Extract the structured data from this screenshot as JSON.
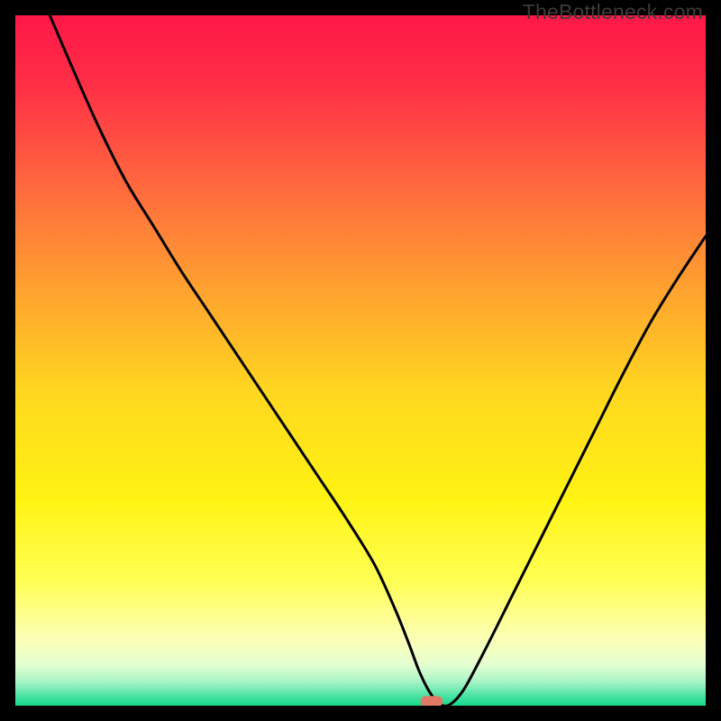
{
  "watermark": "TheBottleneck.com",
  "chart_data": {
    "type": "line",
    "title": "",
    "xlabel": "",
    "ylabel": "",
    "xlim": [
      0,
      100
    ],
    "ylim": [
      0,
      100
    ],
    "grid": false,
    "legend": false,
    "background_gradient": {
      "stops": [
        {
          "offset": 0.0,
          "color": "#ff1848"
        },
        {
          "offset": 0.1,
          "color": "#ff2e46"
        },
        {
          "offset": 0.25,
          "color": "#ff6a3e"
        },
        {
          "offset": 0.4,
          "color": "#ffa32f"
        },
        {
          "offset": 0.55,
          "color": "#ffd81f"
        },
        {
          "offset": 0.7,
          "color": "#fff313"
        },
        {
          "offset": 0.82,
          "color": "#ffff55"
        },
        {
          "offset": 0.9,
          "color": "#fcffb3"
        },
        {
          "offset": 0.94,
          "color": "#e6ffd1"
        },
        {
          "offset": 0.965,
          "color": "#a8f5c6"
        },
        {
          "offset": 0.985,
          "color": "#4fe3a6"
        },
        {
          "offset": 1.0,
          "color": "#16d98b"
        }
      ]
    },
    "series": [
      {
        "name": "bottleneck-curve",
        "x": [
          5,
          8,
          12,
          16,
          20,
          24,
          28,
          32,
          36,
          40,
          44,
          48,
          52,
          55,
          57,
          58.5,
          60,
          61.5,
          63,
          65,
          68,
          72,
          76,
          80,
          84,
          88,
          92,
          96,
          100
        ],
        "y": [
          100,
          93,
          84,
          76,
          69.5,
          63,
          57,
          51,
          45,
          39,
          33,
          27,
          20.5,
          14,
          9,
          5,
          2,
          0.2,
          0.2,
          2.4,
          8,
          16,
          24,
          32,
          40,
          48,
          55.5,
          62,
          68
        ]
      }
    ],
    "marker": {
      "name": "optimal-point",
      "x": 60.3,
      "y": 0.6,
      "width_pct": 3.2,
      "height_pct": 1.6,
      "color": "#e07a66"
    }
  }
}
